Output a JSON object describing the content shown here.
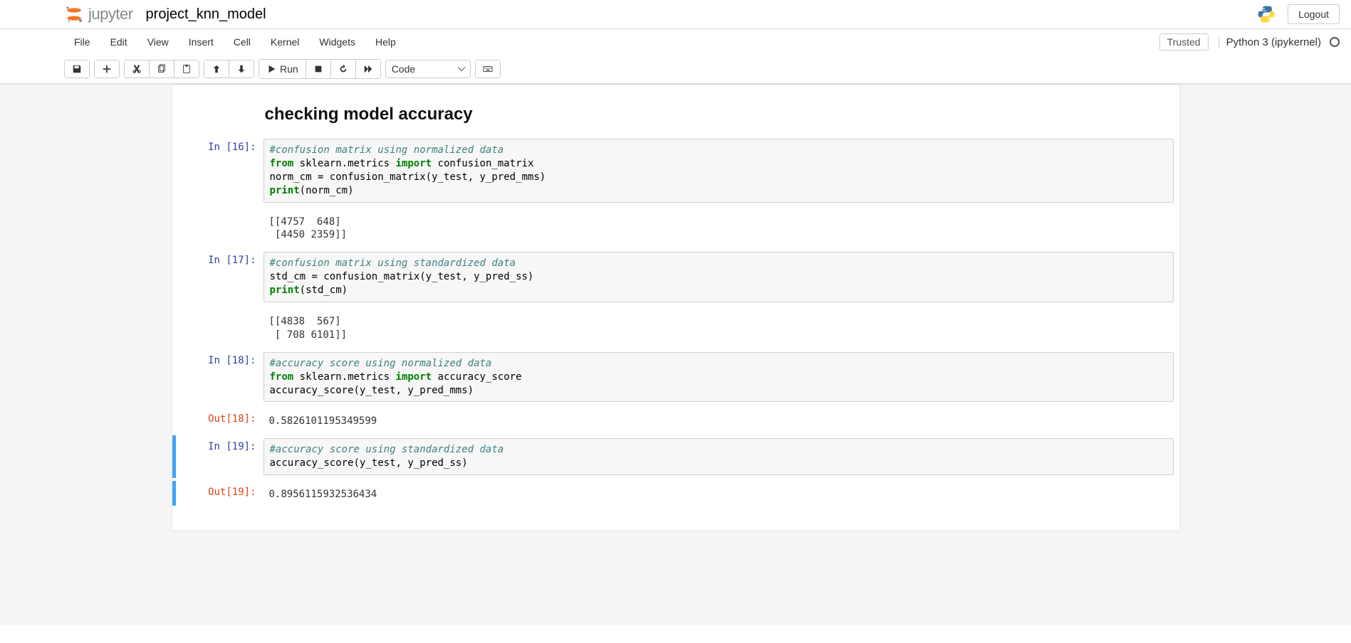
{
  "header": {
    "brand": "jupyter",
    "notebook_name": "project_knn_model",
    "logout": "Logout"
  },
  "menubar": {
    "items": [
      "File",
      "Edit",
      "View",
      "Insert",
      "Cell",
      "Kernel",
      "Widgets",
      "Help"
    ],
    "trusted": "Trusted",
    "kernel": "Python 3 (ipykernel)"
  },
  "toolbar": {
    "run": "Run",
    "cell_type": "Code"
  },
  "cells": {
    "heading": "checking model accuracy",
    "c16": {
      "prompt": "In [16]:",
      "comment": "#confusion matrix using normalized data",
      "line2_a": "from",
      "line2_b": " sklearn.metrics ",
      "line2_c": "import",
      "line2_d": " confusion_matrix",
      "line3": "norm_cm = confusion_matrix(y_test, y_pred_mms)",
      "line4_a": "print",
      "line4_b": "(norm_cm)",
      "output": "[[4757  648]\n [4450 2359]]"
    },
    "c17": {
      "prompt": "In [17]:",
      "comment": "#confusion matrix using standardized data",
      "line2": "std_cm = confusion_matrix(y_test, y_pred_ss)",
      "line3_a": "print",
      "line3_b": "(std_cm)",
      "output": "[[4838  567]\n [ 708 6101]]"
    },
    "c18": {
      "prompt": "In [18]:",
      "comment": "#accuracy score using normalized data",
      "line2_a": "from",
      "line2_b": " sklearn.metrics ",
      "line2_c": "import",
      "line2_d": " accuracy_score",
      "line3": "accuracy_score(y_test, y_pred_mms)",
      "out_prompt": "Out[18]:",
      "output": "0.5826101195349599"
    },
    "c19": {
      "prompt": "In [19]:",
      "comment": "#accuracy score using standardized data",
      "line2": "accuracy_score(y_test, y_pred_ss)",
      "out_prompt": "Out[19]:",
      "output": "0.8956115932536434"
    }
  }
}
